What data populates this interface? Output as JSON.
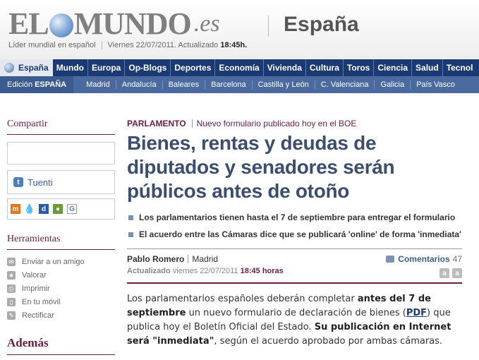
{
  "header": {
    "logo_main_left": "EL",
    "logo_main_right": "MUNDO",
    "logo_suffix": ".es",
    "section": "España",
    "tagline": "Líder mundial en español",
    "date_text": "Viernes 22/07/2011. Actualizado",
    "update_time": "18:45h."
  },
  "nav": {
    "home_label": "España",
    "items": [
      "Mundo",
      "Europa",
      "Op-Blogs",
      "Deportes",
      "Economía",
      "Vivienda",
      "Cultura",
      "Toros",
      "Ciencia",
      "Salud",
      "Tecnol"
    ]
  },
  "subnav": {
    "edition_prefix": "Edición",
    "edition_name": "ESPAÑA",
    "items": [
      "Madrid",
      "Andalucía",
      "Baleares",
      "Barcelona",
      "Castilla y León",
      "C. Valenciana",
      "Galicia",
      "País Vasco"
    ]
  },
  "sidebar": {
    "share_heading": "Compartir",
    "tuenti_label": "Tuenti",
    "tools_heading": "Herramientas",
    "tools": [
      "Enviar a un amigo",
      "Valorar",
      "Imprimir",
      "En tu móvil",
      "Rectificar"
    ],
    "more_heading": "Además"
  },
  "article": {
    "category": "PARLAMENTO",
    "subcategory": "Nuevo formulario publicado hoy en el BOE",
    "headline": "Bienes, rentas y deudas de diputados y senadores serán públicos antes de otoño",
    "bullets": [
      "Los parlamentarios tienen hasta el 7 de septiembre para entregar el formulario",
      "El acuerdo entre las Cámaras dice que se publicará 'online' de forma 'inmediata'"
    ],
    "author": "Pablo Romero",
    "location": "Madrid",
    "updated_label": "Actualizado",
    "updated_date": "viernes 22/07/2011",
    "updated_time": "18:45 horas",
    "comments_label": "Comentarios",
    "comments_count": "47",
    "body": {
      "p1_a": "Los parlamentarios españoles deberán completar ",
      "p1_b": "antes del 7 de septiembre",
      "p1_c": " un nuevo formulario de declaración de bienes (",
      "p1_link": "PDF",
      "p1_d": ") que publica hoy el Boletín Oficial del Estado. ",
      "p1_e": "Su publicación en Internet será \"inmediata\"",
      "p1_f": ", según el acuerdo aprobado por ambas cámaras."
    }
  },
  "colors": {
    "nav_blue": "#1b3a74",
    "maroon": "#6b1d3f",
    "headline": "#3c4e6e"
  }
}
